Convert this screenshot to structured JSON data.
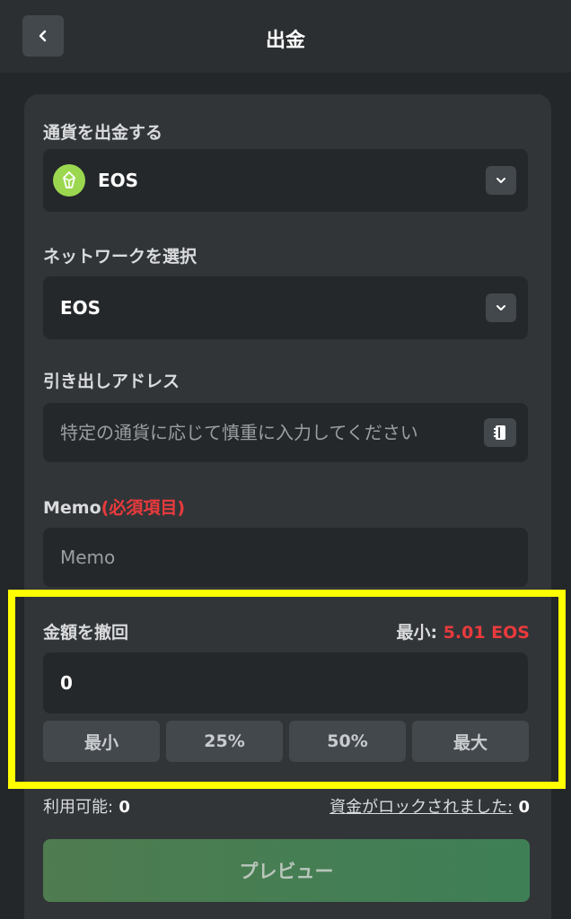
{
  "header": {
    "title": "出金"
  },
  "currency": {
    "label": "通貨を出金する",
    "selected": "EOS"
  },
  "network": {
    "label": "ネットワークを選択",
    "selected": "EOS"
  },
  "address": {
    "label": "引き出しアドレス",
    "placeholder": "特定の通貨に応じて慎重に入力してください"
  },
  "memo": {
    "label": "Memo",
    "required": "(必須項目)",
    "placeholder": "Memo"
  },
  "amount": {
    "label": "金額を撤回",
    "min_label": "最小:",
    "min_value": "5.01 EOS",
    "value": "0",
    "buttons": [
      "最小",
      "25%",
      "50%",
      "最大"
    ]
  },
  "footer": {
    "available_label": "利用可能:",
    "available_value": "0",
    "locked_label": "資金がロックされました:",
    "locked_value": "0"
  },
  "preview_button": "プレビュー",
  "colors": {
    "accent_red": "#ea3a3d",
    "highlight": "#ffff00",
    "coin": "#9bd84f"
  }
}
